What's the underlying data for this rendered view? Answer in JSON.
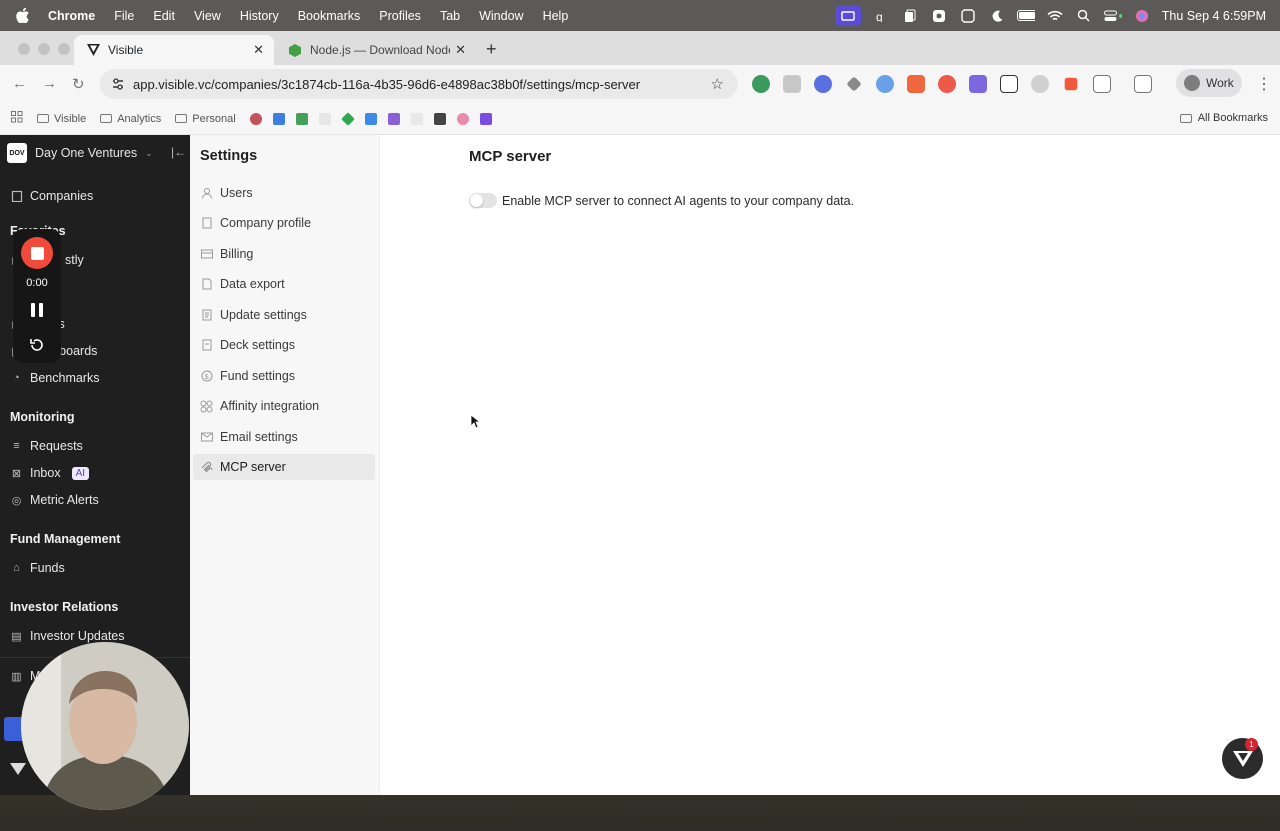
{
  "menubar": {
    "app": "Chrome",
    "items": [
      "File",
      "Edit",
      "View",
      "History",
      "Bookmarks",
      "Profiles",
      "Tab",
      "Window",
      "Help"
    ],
    "clock": "Thu Sep 4  6:59PM"
  },
  "browser": {
    "tabs": [
      {
        "title": "Visible",
        "active": true
      },
      {
        "title": "Node.js — Download Node.js®",
        "active": false
      }
    ],
    "url": "app.visible.vc/companies/3c1874cb-116a-4b35-96d6-e4898ac38b0f/settings/mcp-server",
    "profile": "Work",
    "bookmarks": [
      "Visible",
      "Analytics",
      "Personal"
    ],
    "all_bookmarks": "All Bookmarks"
  },
  "sidebar": {
    "org": "Day One Ventures",
    "logo_text": "DOV",
    "companies": "Companies",
    "favorites_heading": "Favorites",
    "favorites_item": "stly",
    "item_partial": "ts",
    "dashboards": "Dashboards",
    "benchmarks": "Benchmarks",
    "sections": {
      "monitoring": "Monitoring",
      "fund_management": "Fund Management",
      "investor_relations": "Investor Relations"
    },
    "monitoring_items": [
      "Requests",
      "Inbox",
      "Metric Alerts"
    ],
    "inbox_badge": "AI",
    "fund_items": [
      "Funds"
    ],
    "ir_items": [
      "Investor Updates"
    ],
    "bottom_partial": "M"
  },
  "settings": {
    "title": "Settings",
    "items": [
      {
        "label": "Users",
        "icon": "user-icon"
      },
      {
        "label": "Company profile",
        "icon": "building-icon"
      },
      {
        "label": "Billing",
        "icon": "card-icon"
      },
      {
        "label": "Data export",
        "icon": "export-icon"
      },
      {
        "label": "Update settings",
        "icon": "doc-icon"
      },
      {
        "label": "Deck settings",
        "icon": "deck-icon"
      },
      {
        "label": "Fund settings",
        "icon": "dollar-icon"
      },
      {
        "label": "Affinity integration",
        "icon": "affinity-icon"
      },
      {
        "label": "Email settings",
        "icon": "mail-icon"
      },
      {
        "label": "MCP server",
        "icon": "mcp-icon",
        "active": true
      }
    ]
  },
  "main": {
    "title": "MCP server",
    "toggle_label": "Enable MCP server to connect AI agents to your company data.",
    "toggle_on": false
  },
  "recorder": {
    "time": "0:00"
  },
  "chat": {
    "badge": "1"
  }
}
